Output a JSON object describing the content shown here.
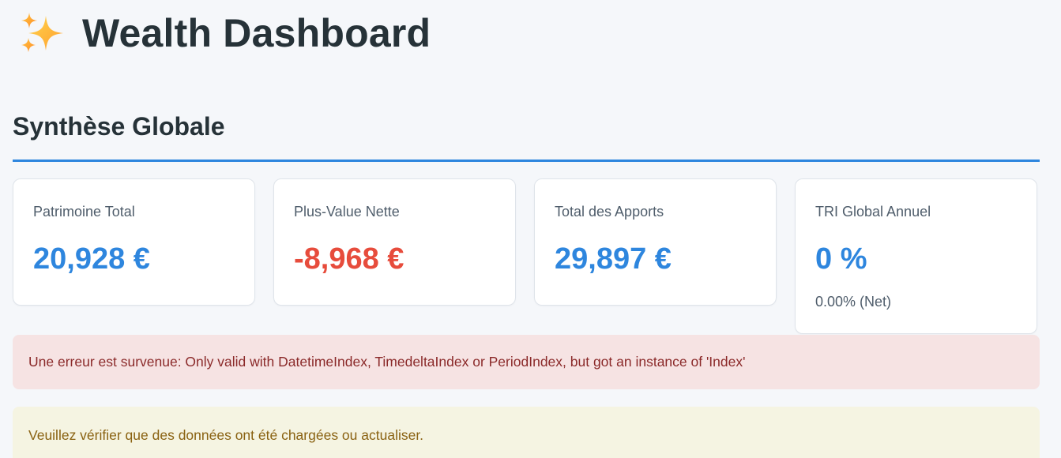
{
  "header": {
    "title": "Wealth Dashboard",
    "icon": "sparkles-icon"
  },
  "section": {
    "title": "Synthèse Globale",
    "accent_color": "#2e86de"
  },
  "metrics": [
    {
      "label": "Patrimoine Total",
      "value": "20,928 €",
      "color": "#2e86de"
    },
    {
      "label": "Plus-Value Nette",
      "value": "-8,968 €",
      "color": "#e74c3c"
    },
    {
      "label": "Total des Apports",
      "value": "29,897 €",
      "color": "#2e86de"
    },
    {
      "label": "TRI Global Annuel",
      "value": "0 %",
      "sub": "0.00% (Net)",
      "color": "#2e86de"
    }
  ],
  "alerts": {
    "error": {
      "text": "Une erreur est survenue: Only valid with DatetimeIndex, TimedeltaIndex or PeriodIndex, but got an instance of 'Index'",
      "color": "#8b2a2a",
      "background": "#f6e3e3"
    },
    "warning": {
      "text": "Veuillez vérifier que des données ont été chargées ou actualiser.",
      "color": "#8a6212",
      "background": "#f5f4e2"
    }
  }
}
